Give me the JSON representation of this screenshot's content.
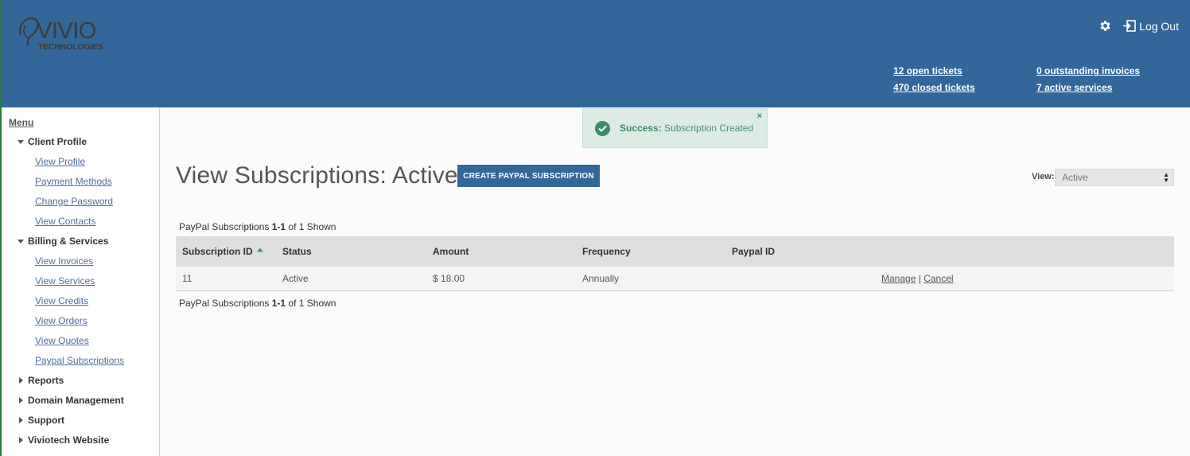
{
  "header": {
    "logo_text": "VIVIO",
    "logo_subtext": "TECHNOLOGIES",
    "logout_label": "Log Out",
    "stats": {
      "open_tickets": "12 open tickets",
      "closed_tickets": "470 closed tickets",
      "outstanding_invoices": "0 outstanding invoices",
      "active_services": "7 active services"
    }
  },
  "sidebar": {
    "menu_title": "Menu",
    "groups": [
      {
        "label": "Client Profile",
        "expanded": true,
        "items": [
          "View Profile",
          "Payment Methods",
          "Change Password",
          "View Contacts"
        ]
      },
      {
        "label": "Billing & Services",
        "expanded": true,
        "items": [
          "View Invoices",
          "View Services",
          "View Credits",
          "View Orders",
          "View Quotes",
          "Paypal Subscriptions"
        ]
      },
      {
        "label": "Reports",
        "expanded": false
      },
      {
        "label": "Domain Management",
        "expanded": false
      },
      {
        "label": "Support",
        "expanded": false
      },
      {
        "label": "Viviotech Website",
        "expanded": false
      }
    ]
  },
  "alert": {
    "strong": "Success:",
    "message": "Subscription Created",
    "close": "×"
  },
  "main": {
    "title": "View Subscriptions: Active",
    "create_button": "CREATE PAYPAL SUBSCRIPTION",
    "view_label": "View:",
    "view_value": "Active",
    "shown_prefix": "PayPal Subscriptions",
    "shown_range": "1-1",
    "shown_suffix": "of 1 Shown"
  },
  "table": {
    "columns": [
      "Subscription ID",
      "Status",
      "Amount",
      "Frequency",
      "Paypal ID"
    ],
    "rows": [
      {
        "id": "11",
        "status": "Active",
        "amount": "$ 18.00",
        "frequency": "Annually",
        "paypal_id": "",
        "manage": "Manage",
        "sep": "|",
        "cancel": "Cancel"
      }
    ]
  },
  "colors": {
    "header_bg": "#336699",
    "success_bg": "#dcebe4",
    "success_text": "#3b8c6b",
    "link": "#4f6f9b"
  }
}
